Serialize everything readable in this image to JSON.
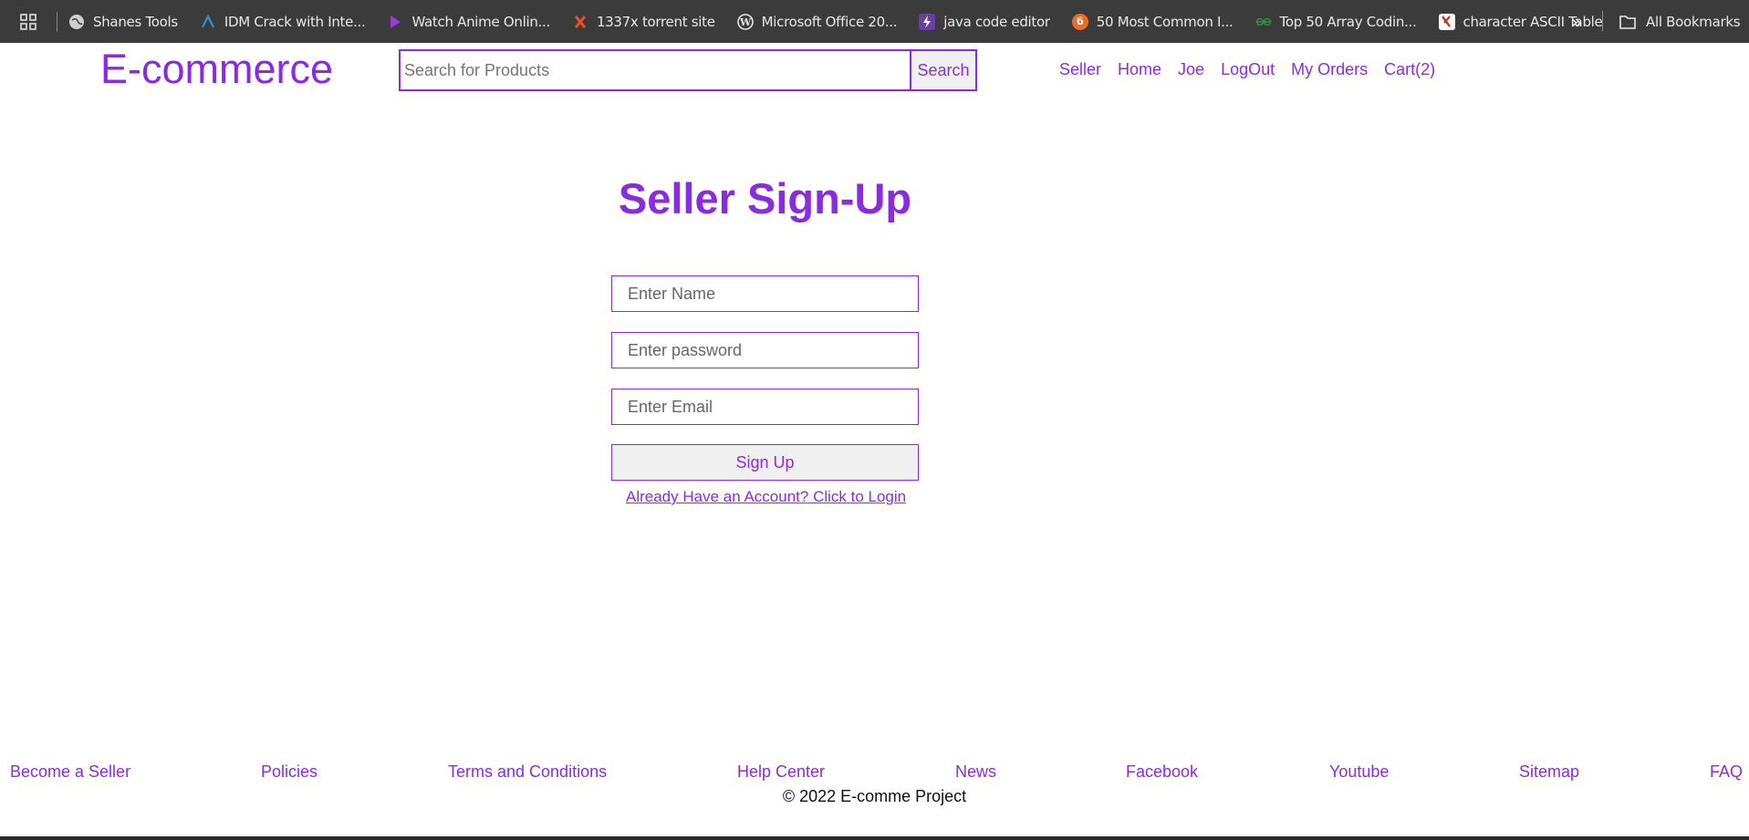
{
  "bookmarks": {
    "items": [
      {
        "label": "Shanes Tools",
        "icon": "globe-icon",
        "color": "#cfcfcf"
      },
      {
        "label": "IDM Crack with Inte...",
        "icon": "idm-icon",
        "color": "#2a8fd8"
      },
      {
        "label": "Watch Anime Onlin...",
        "icon": "play-icon",
        "color": "#9b3ad6"
      },
      {
        "label": "1337x torrent site",
        "icon": "x-icon",
        "color": "#e8502a"
      },
      {
        "label": "Microsoft Office 20...",
        "icon": "wordpress-icon",
        "color": "#e8e8e8"
      },
      {
        "label": "java code editor",
        "icon": "bolt-icon",
        "color": "#6b3fa0"
      },
      {
        "label": "50 Most Common I...",
        "icon": "brand-icon",
        "color": "#f06a2a"
      },
      {
        "label": "Top 50 Array Codin...",
        "icon": "gfg-icon",
        "color": "#2f8d46"
      },
      {
        "label": "character ASCII Table",
        "icon": "ascii-icon",
        "color": "#c0392b"
      }
    ],
    "more": "»",
    "all_bookmarks": "All Bookmarks"
  },
  "header": {
    "logo": "E-commerce",
    "search": {
      "placeholder": "Search for Products",
      "button": "Search"
    },
    "nav": [
      "Seller",
      "Home",
      "Joe",
      "LogOut",
      "My Orders",
      "Cart(2)"
    ]
  },
  "main": {
    "title": "Seller Sign-Up",
    "fields": {
      "name_placeholder": "Enter Name",
      "password_placeholder": "Enter password",
      "email_placeholder": "Enter Email"
    },
    "signup_button": "Sign Up",
    "login_link": "Already Have an Account? Click to Login"
  },
  "footer": {
    "links": [
      "Become a Seller",
      "Policies",
      "Terms and Conditions",
      "Help Center",
      "News",
      "Facebook",
      "Youtube",
      "Sitemap",
      "FAQ"
    ],
    "copyright": "© 2022 E-comme Project"
  },
  "colors": {
    "accent": "#8a2be2",
    "bookmarks_bar": "#3b3b3b"
  }
}
